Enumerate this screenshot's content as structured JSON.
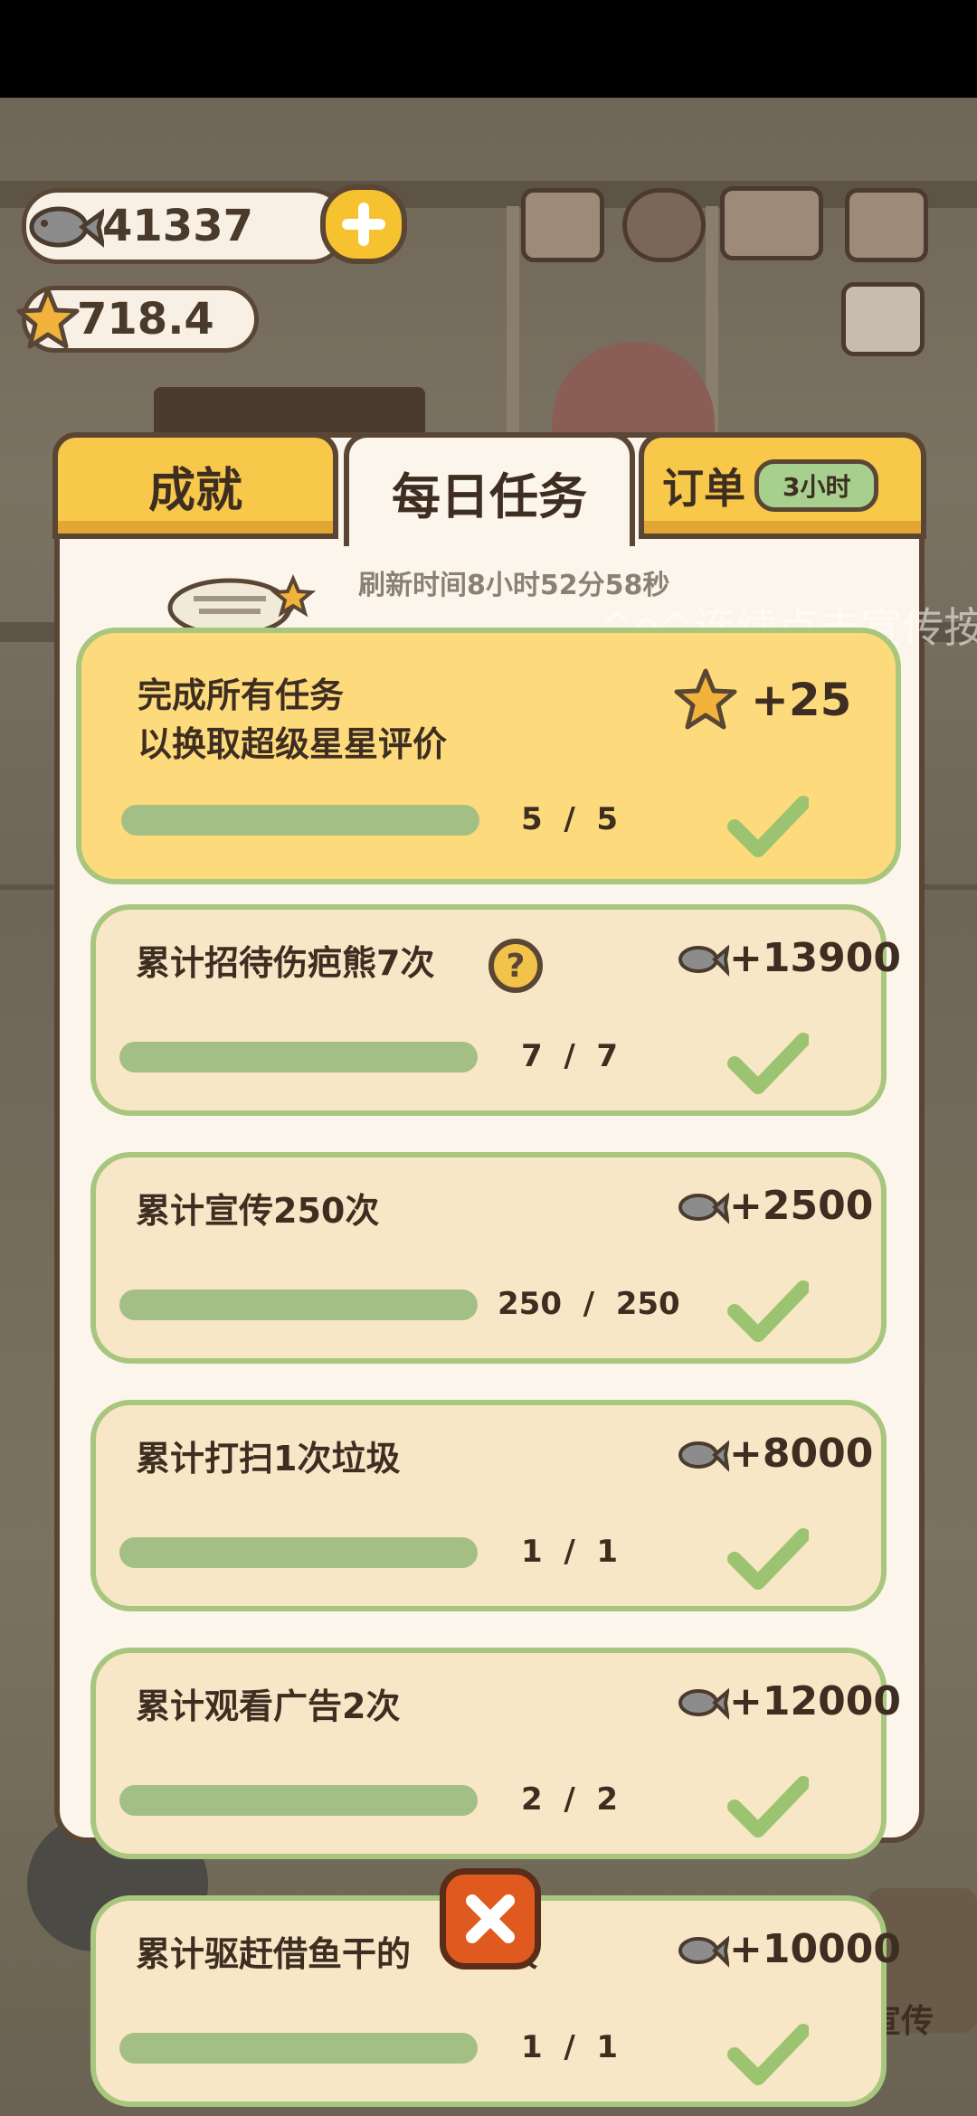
{
  "currency": {
    "fish": "41337",
    "stars": "718.4"
  },
  "tabs": {
    "achievements": "成就",
    "daily": "每日任务",
    "orders": "订单",
    "orders_badge": "3小时"
  },
  "refresh_text": "刷新时间8小时52分58秒",
  "overlay_text": "^o^连续点击宣传按",
  "tasks": [
    {
      "title_line1": "完成所有任务",
      "title_line2": "以换取超级星星评价",
      "reward": "+25",
      "reward_icon": "star-icon",
      "progress": "5  /  5",
      "done": 5,
      "total": 5
    },
    {
      "title_line1": "累计招待伤疤熊7次",
      "reward": "+13900",
      "reward_icon": "fish-icon",
      "progress": "7  /  7",
      "done": 7,
      "total": 7
    },
    {
      "title_line1": "累计宣传250次",
      "reward": "+2500",
      "reward_icon": "fish-icon",
      "progress": "250  /  250",
      "done": 250,
      "total": 250
    },
    {
      "title_line1": "累计打扫1次垃圾",
      "reward": "+8000",
      "reward_icon": "fish-icon",
      "progress": "1  /  1",
      "done": 1,
      "total": 1
    },
    {
      "title_line1": "累计观看广告2次",
      "reward": "+12000",
      "reward_icon": "fish-icon",
      "progress": "2  /  2",
      "done": 2,
      "total": 2
    },
    {
      "title_line1": "累计驱赶借鱼干的",
      "title_line1_tail": "1次",
      "reward": "+10000",
      "reward_icon": "fish-icon",
      "progress": "1  /  1",
      "done": 1,
      "total": 1
    }
  ],
  "side_label": "宣传",
  "colors": {
    "tab_yellow": "#f7c84a",
    "card_bg": "#f7e7c6",
    "card_border": "#a8c67e",
    "check_green": "#9cc36f",
    "close_orange": "#e05a20"
  }
}
